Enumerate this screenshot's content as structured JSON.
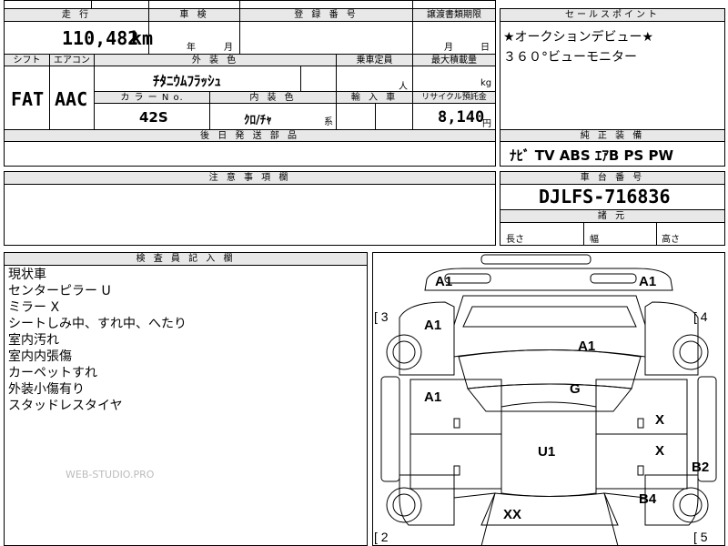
{
  "summary": {
    "headers": {
      "mileage": "走 行",
      "inspection": "車 検",
      "registration": "登 録 番 号",
      "transfer_deadline": "譲渡書類期限"
    },
    "mileage_value": "110,482",
    "mileage_unit": "km",
    "inspection_year_unit": "年",
    "inspection_month_unit": "月",
    "transfer_month_unit": "月",
    "transfer_day_unit": "日"
  },
  "specs": {
    "headers": {
      "shift": "シフト",
      "aircon": "エアコン",
      "exterior_color": "外 装 色",
      "capacity": "乗車定員",
      "max_load": "最大積載量",
      "color_no": "カ ラ ー N o.",
      "interior_color": "内 装 色",
      "import": "輸 入 車",
      "recycle": "リサイクル預託金"
    },
    "shift": "FAT",
    "aircon": "AAC",
    "exterior_color": "ﾁﾀﾆｳﾑﾌﾗｯｼｭ",
    "capacity_unit": "人",
    "max_load_unit": "kg",
    "color_no": "42S",
    "interior_color": "ｸﾛ/ﾁｬ",
    "interior_suffix": "系",
    "recycle_value": "8,140",
    "recycle_unit": "円"
  },
  "deferred_parts_header": "後 日 発 送 部 品",
  "sales_points": {
    "header": "セールスポイント",
    "lines": [
      "★オークションデビュー★",
      "３６０°ビューモニター"
    ]
  },
  "standard_equipment": {
    "header": "純 正 装 備",
    "value": "ﾅﾋﾞ  TV  ABS ｴｱB PS PW"
  },
  "caution_header": "注 意 事 項 欄",
  "chassis": {
    "header": "車 台 番 号",
    "value": "DJLFS-716836"
  },
  "dimensions": {
    "header": "諸 元",
    "length": "長さ",
    "width": "幅",
    "height": "高さ"
  },
  "inspector": {
    "header": "検 査 員 記 入 欄",
    "notes": [
      "現状車",
      "センターピラー U",
      "ミラー X",
      "シートしみ中、すれ中、へたり",
      "室内汚れ",
      "室内内張傷",
      "カーペットすれ",
      "外装小傷有り",
      "スタッドレスタイヤ"
    ]
  },
  "watermark": "WEB-STUDIO.PRO",
  "diagram": {
    "marks": {
      "a1_tl": "A1",
      "a1_tr": "A1",
      "a1_hood": "A1",
      "a1_front_right": "A1",
      "a1_left_mid": "A1",
      "g": "G",
      "x1": "X",
      "x2": "X",
      "u1": "U1",
      "b2": "B2",
      "b4": "B4",
      "xx": "XX"
    },
    "brackets": {
      "b3": "[ 3",
      "b4": "[ 4",
      "b2": "[ 2",
      "b5": "[ 5"
    }
  }
}
